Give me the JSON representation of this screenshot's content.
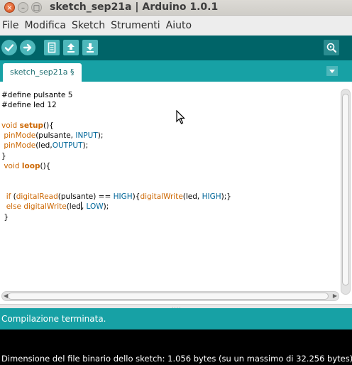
{
  "window": {
    "title": "sketch_sep21a | Arduino 1.0.1",
    "buttons": {
      "close": "×",
      "minimize": "–",
      "maximize": "□"
    }
  },
  "menu": [
    "File",
    "Modifica",
    "Sketch",
    "Strumenti",
    "Aiuto"
  ],
  "toolbar": {
    "buttons": [
      "verify-icon",
      "upload-icon",
      "new-icon",
      "open-icon",
      "save-icon"
    ],
    "right_button": "serial-monitor-icon",
    "colors": {
      "bar": "#006468",
      "button": "#4db7bb"
    }
  },
  "tabs": [
    {
      "label": "sketch_sep21a §"
    }
  ],
  "editor": {
    "lines": [
      "#define pulsante 5",
      "#define led 12",
      "",
      "void setup(){",
      " pinMode(pulsante, INPUT);",
      " pinMode(led,OUTPUT);",
      "}",
      " void loop(){",
      "",
      "",
      "  if (digitalRead(pulsante) == HIGH){digitalWrite(led, HIGH);}",
      "  else digitalWrite(led, LOW);",
      " }"
    ]
  },
  "status": {
    "message": "Compilazione terminata."
  },
  "console": {
    "text": "Dimensione del file binario dello sketch: 1.056 bytes (su un massimo di 32.256 bytes)"
  }
}
